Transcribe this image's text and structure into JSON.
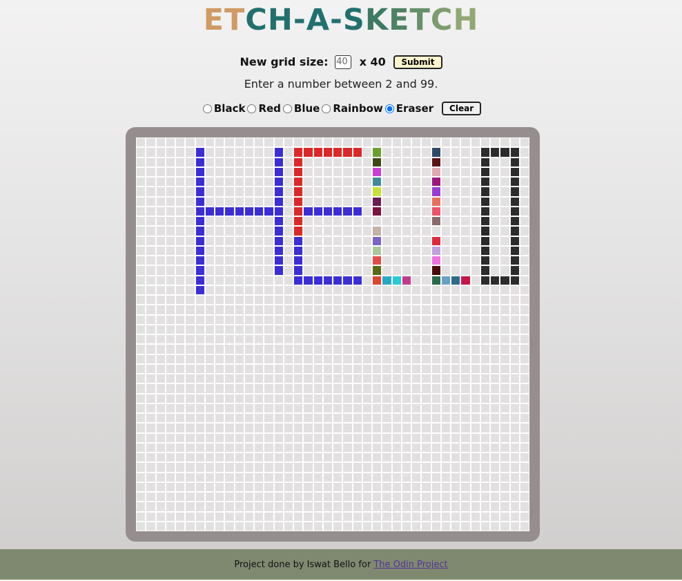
{
  "title": {
    "letters": [
      "E",
      "T",
      "C",
      "H",
      "-",
      "A",
      "-",
      "S",
      "K",
      "E",
      "T",
      "C",
      "H"
    ],
    "colors": [
      "#cf9a63",
      "#cf9a63",
      "#22706d",
      "#22706d",
      "#22706d",
      "#22706d",
      "#22706d",
      "#22706d",
      "#3d7a63",
      "#4f8264",
      "#66906a",
      "#7d9c6f",
      "#90a874"
    ]
  },
  "controls": {
    "grid_size_label": "New grid size:",
    "grid_size_value": "40",
    "grid_size_suffix": "x 40",
    "submit_label": "Submit",
    "hint": "Enter a number between 2 and 99.",
    "modes": [
      {
        "label": "Black",
        "checked": false
      },
      {
        "label": "Red",
        "checked": false
      },
      {
        "label": "Blue",
        "checked": false
      },
      {
        "label": "Rainbow",
        "checked": false
      },
      {
        "label": "Eraser",
        "checked": true
      }
    ],
    "clear_label": "Clear"
  },
  "grid": {
    "size": 40,
    "empty_color": "#e2e0e0",
    "painted": [
      {
        "color": "#3c2ed6",
        "cells": [
          [
            1,
            6
          ],
          [
            2,
            6
          ],
          [
            3,
            6
          ],
          [
            4,
            6
          ],
          [
            5,
            6
          ],
          [
            6,
            6
          ],
          [
            7,
            6
          ],
          [
            8,
            6
          ],
          [
            9,
            6
          ],
          [
            10,
            6
          ],
          [
            11,
            6
          ],
          [
            12,
            6
          ],
          [
            13,
            6
          ],
          [
            14,
            6
          ],
          [
            15,
            6
          ],
          [
            7,
            7
          ],
          [
            7,
            8
          ],
          [
            7,
            9
          ],
          [
            7,
            10
          ],
          [
            7,
            11
          ],
          [
            7,
            12
          ],
          [
            7,
            13
          ],
          [
            7,
            14
          ],
          [
            1,
            14
          ],
          [
            2,
            14
          ],
          [
            3,
            14
          ],
          [
            4,
            14
          ],
          [
            5,
            14
          ],
          [
            6,
            14
          ],
          [
            8,
            14
          ],
          [
            9,
            14
          ],
          [
            10,
            14
          ],
          [
            11,
            14
          ],
          [
            12,
            14
          ],
          [
            13,
            14
          ],
          [
            7,
            17
          ],
          [
            7,
            18
          ],
          [
            7,
            19
          ],
          [
            7,
            20
          ],
          [
            7,
            21
          ],
          [
            7,
            22
          ],
          [
            10,
            16
          ],
          [
            11,
            16
          ],
          [
            12,
            16
          ],
          [
            13,
            16
          ],
          [
            14,
            16
          ],
          [
            14,
            17
          ],
          [
            14,
            18
          ],
          [
            14,
            19
          ],
          [
            14,
            20
          ],
          [
            14,
            21
          ],
          [
            14,
            22
          ]
        ]
      },
      {
        "color": "#dc2828",
        "cells": [
          [
            1,
            16
          ],
          [
            1,
            17
          ],
          [
            1,
            18
          ],
          [
            1,
            19
          ],
          [
            1,
            20
          ],
          [
            1,
            21
          ],
          [
            1,
            22
          ],
          [
            2,
            16
          ],
          [
            3,
            16
          ],
          [
            4,
            16
          ],
          [
            5,
            16
          ],
          [
            6,
            16
          ],
          [
            7,
            16
          ],
          [
            8,
            16
          ],
          [
            9,
            16
          ]
        ]
      },
      {
        "color": "#2c2c2c",
        "cells": [
          [
            1,
            35
          ],
          [
            1,
            36
          ],
          [
            1,
            37
          ],
          [
            1,
            38
          ],
          [
            2,
            35
          ],
          [
            3,
            35
          ],
          [
            4,
            35
          ],
          [
            5,
            35
          ],
          [
            6,
            35
          ],
          [
            7,
            35
          ],
          [
            8,
            35
          ],
          [
            9,
            35
          ],
          [
            10,
            35
          ],
          [
            11,
            35
          ],
          [
            12,
            35
          ],
          [
            13,
            35
          ],
          [
            14,
            35
          ],
          [
            14,
            36
          ],
          [
            14,
            37
          ],
          [
            14,
            38
          ],
          [
            2,
            38
          ],
          [
            3,
            38
          ],
          [
            4,
            38
          ],
          [
            5,
            38
          ],
          [
            6,
            38
          ],
          [
            7,
            38
          ],
          [
            8,
            38
          ],
          [
            9,
            38
          ],
          [
            10,
            38
          ],
          [
            11,
            38
          ],
          [
            12,
            38
          ],
          [
            13,
            38
          ]
        ]
      },
      {
        "color": "",
        "cells_colored": [
          [
            1,
            24,
            "#6aa02e"
          ],
          [
            2,
            24,
            "#3d4a14"
          ],
          [
            3,
            24,
            "#c93fd6"
          ],
          [
            4,
            24,
            "#3f8a9a"
          ],
          [
            5,
            24,
            "#c8e03a"
          ],
          [
            6,
            24,
            "#6b1c55"
          ],
          [
            7,
            24,
            "#7a1440"
          ],
          [
            9,
            24,
            "#c2b2a8"
          ],
          [
            10,
            24,
            "#7a62c8"
          ],
          [
            11,
            24,
            "#a8c89a"
          ],
          [
            12,
            24,
            "#e84a4a"
          ],
          [
            13,
            24,
            "#5a6a12"
          ],
          [
            14,
            24,
            "#e0442e"
          ],
          [
            14,
            25,
            "#2aa6c9"
          ],
          [
            14,
            26,
            "#2ac8d6"
          ],
          [
            14,
            27,
            "#c63a8e"
          ],
          [
            1,
            30,
            "#2d4a66"
          ],
          [
            2,
            30,
            "#5a1414"
          ],
          [
            3,
            30,
            "#e0a8b0"
          ],
          [
            4,
            30,
            "#a01480"
          ],
          [
            5,
            30,
            "#9a3ad6"
          ],
          [
            6,
            30,
            "#e8705a"
          ],
          [
            7,
            30,
            "#f0506a"
          ],
          [
            8,
            30,
            "#8a6a6a"
          ],
          [
            10,
            30,
            "#e0283a"
          ],
          [
            11,
            30,
            "#c0a0e0"
          ],
          [
            12,
            30,
            "#f070e0"
          ],
          [
            13,
            30,
            "#4a0a0a"
          ],
          [
            14,
            30,
            "#286a4a"
          ],
          [
            14,
            31,
            "#6aa0c8"
          ],
          [
            14,
            32,
            "#2e6a8a"
          ],
          [
            14,
            33,
            "#c81448"
          ]
        ]
      }
    ]
  },
  "footer": {
    "text": "Project done by Iswat Bello for ",
    "link_text": "The Odin Project"
  }
}
